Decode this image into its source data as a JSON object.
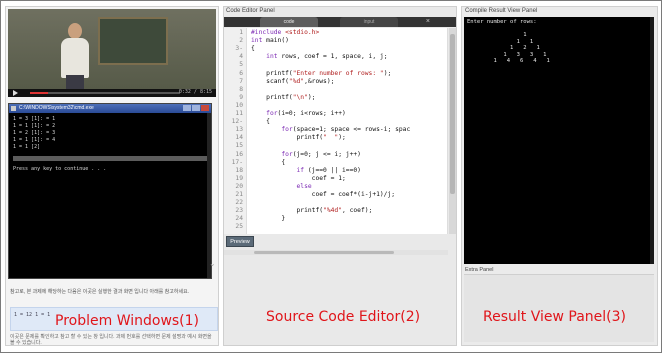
{
  "problem_panel": {
    "video": {
      "time": "0:32 / 8:15",
      "progress_fraction": 0.12
    },
    "console": {
      "title": "C:\\WINDOWS\\system32\\cmd.exe",
      "lines": [
        "1 = 3 [1]: = 1",
        "1 = 1 [1]: = 2",
        "1 = 2 [1]: = 3",
        "1 = 1 [1]: = 4",
        "1 = 1 [2]"
      ],
      "footer_text": "Press any key to continue . . ."
    },
    "note": "참고로, 본 과제에 해당하는 다음은 이곳은 실행한 결과 화면 입니다 아래를 참고하세요.",
    "box_mini": [
      "1 = 12",
      "1 = 1"
    ],
    "label": "Problem Windows(1)",
    "footer": "이곳은 문제를 확인하고 참고 할 수 있는 창 입니다. 과제 번호를 선택하면 문제 설명과 예시 화면을 볼 수 있습니다."
  },
  "editor_panel": {
    "title": "Code Editor Panel",
    "tabs": [
      "code",
      "input"
    ],
    "close_glyph": "×",
    "lines": [
      {
        "n": "1",
        "segments": [
          [
            "kw",
            "#include "
          ],
          [
            "str",
            "<stdio.h>"
          ]
        ]
      },
      {
        "n": "2",
        "segments": [
          [
            "kw",
            "int "
          ],
          [
            "",
            "main()"
          ]
        ]
      },
      {
        "n": "3-",
        "segments": [
          [
            "",
            "{"
          ]
        ]
      },
      {
        "n": "4",
        "segments": [
          [
            "",
            "    "
          ],
          [
            "kw",
            "int "
          ],
          [
            "",
            "rows, coef = 1, space, i, j;"
          ]
        ]
      },
      {
        "n": "5",
        "segments": [
          [
            "",
            ""
          ]
        ]
      },
      {
        "n": "6",
        "segments": [
          [
            "",
            "    printf("
          ],
          [
            "str",
            "\"Enter number of rows: \""
          ],
          [
            "",
            ");"
          ]
        ]
      },
      {
        "n": "7",
        "segments": [
          [
            "",
            "    scanf("
          ],
          [
            "str",
            "\"%d\""
          ],
          [
            "",
            ",&rows);"
          ]
        ]
      },
      {
        "n": "8",
        "segments": [
          [
            "",
            ""
          ]
        ]
      },
      {
        "n": "9",
        "segments": [
          [
            "",
            "    printf("
          ],
          [
            "str",
            "\"\\n\""
          ],
          [
            "",
            ");"
          ]
        ]
      },
      {
        "n": "10",
        "segments": [
          [
            "",
            ""
          ]
        ]
      },
      {
        "n": "11",
        "segments": [
          [
            "",
            "    "
          ],
          [
            "kw",
            "for"
          ],
          [
            "",
            "(i=0; i<rows; i++)"
          ]
        ]
      },
      {
        "n": "12-",
        "segments": [
          [
            "",
            "    {"
          ]
        ]
      },
      {
        "n": "13",
        "segments": [
          [
            "",
            "        "
          ],
          [
            "kw",
            "for"
          ],
          [
            "",
            "(space=1; space <= rows-i; spac"
          ]
        ]
      },
      {
        "n": "14",
        "segments": [
          [
            "",
            "            printf("
          ],
          [
            "str",
            "\"  \""
          ],
          [
            "",
            ");"
          ]
        ]
      },
      {
        "n": "15",
        "segments": [
          [
            "",
            ""
          ]
        ]
      },
      {
        "n": "16",
        "segments": [
          [
            "",
            "        "
          ],
          [
            "kw",
            "for"
          ],
          [
            "",
            "(j=0; j <= i; j++)"
          ]
        ]
      },
      {
        "n": "17-",
        "segments": [
          [
            "",
            "        {"
          ]
        ]
      },
      {
        "n": "18",
        "segments": [
          [
            "",
            "            "
          ],
          [
            "kw",
            "if"
          ],
          [
            "",
            " (j==0 || i==0)"
          ]
        ]
      },
      {
        "n": "19",
        "segments": [
          [
            "",
            "                coef = 1;"
          ]
        ]
      },
      {
        "n": "20",
        "segments": [
          [
            "",
            "            "
          ],
          [
            "kw",
            "else"
          ]
        ]
      },
      {
        "n": "21",
        "segments": [
          [
            "",
            "                coef = coef*(i-j+1)/j;"
          ]
        ]
      },
      {
        "n": "22",
        "segments": [
          [
            "",
            ""
          ]
        ]
      },
      {
        "n": "23",
        "segments": [
          [
            "",
            "            printf("
          ],
          [
            "str",
            "\"%4d\""
          ],
          [
            "",
            ", coef);"
          ]
        ]
      },
      {
        "n": "24",
        "segments": [
          [
            "",
            "        }"
          ]
        ]
      },
      {
        "n": "25",
        "segments": [
          [
            "",
            ""
          ]
        ]
      }
    ],
    "preview_button": "Preview",
    "label": "Source Code Editor(2)"
  },
  "result_panel": {
    "title": "Compile Result View Panel",
    "output": [
      "Enter number of rows:",
      "",
      "                 1",
      "               1   1",
      "             1   2   1",
      "           1   3   3   1",
      "        1   4   6   4   1"
    ],
    "extra_title": "Extra Panel",
    "label": "Result View Panel(3)"
  }
}
